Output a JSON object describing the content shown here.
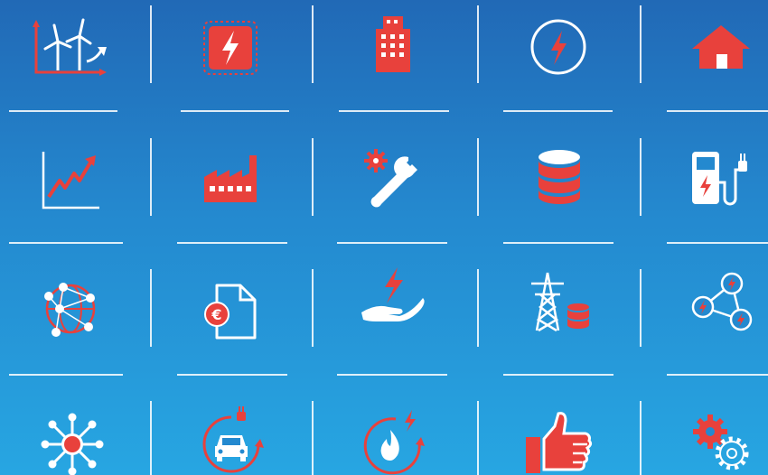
{
  "colors": {
    "accent": "#e8413c",
    "line": "#ffffff",
    "background_top": "#2169b6",
    "background_bottom": "#27a6e2"
  },
  "icons": [
    [
      "wind-energy-growth-icon",
      "power-chip-icon",
      "office-building-icon",
      "power-symbol-icon",
      "house-icon"
    ],
    [
      "growth-chart-icon",
      "factory-icon",
      "maintenance-tools-icon",
      "database-icon",
      "ev-charging-station-icon"
    ],
    [
      "network-globe-icon",
      "euro-invoice-icon",
      "energy-in-hand-icon",
      "power-pylon-storage-icon",
      "energy-network-icon"
    ],
    [
      "network-hub-icon",
      "electric-car-cycle-icon",
      "gas-energy-cycle-icon",
      "thumbs-up-icon",
      "settings-gears-icon"
    ]
  ]
}
